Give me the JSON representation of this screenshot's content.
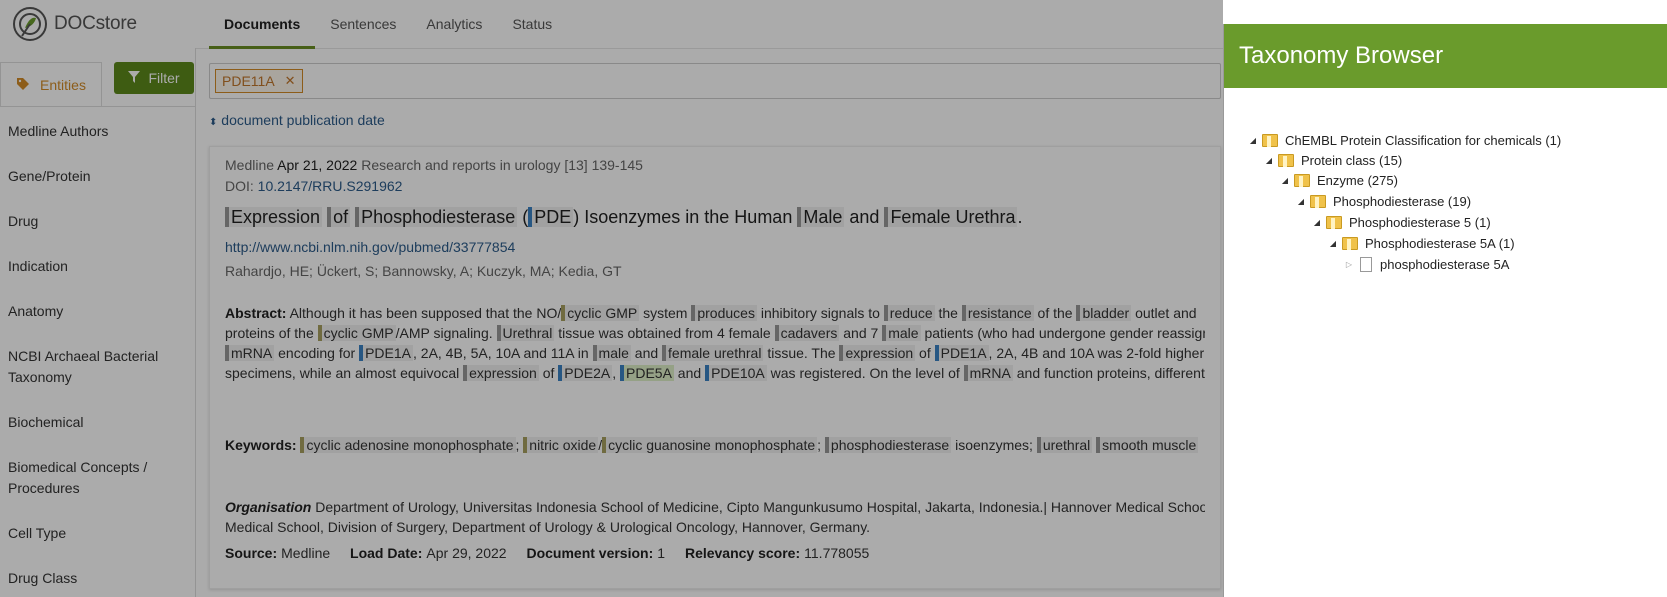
{
  "app": {
    "name": "DOCstore"
  },
  "nav": {
    "tabs": [
      "Documents",
      "Sentences",
      "Analytics",
      "Status"
    ],
    "active": "Documents"
  },
  "sidebar": {
    "tab_label": "Entities",
    "filter_label": "Filter",
    "items": [
      "Medline Authors",
      "Gene/Protein",
      "Drug",
      "Indication",
      "Anatomy",
      "NCBI Archaeal Bacterial Taxonomy",
      "Biochemical",
      "Biomedical Concepts / Procedures",
      "Cell Type",
      "Drug Class"
    ]
  },
  "search": {
    "chip": "PDE11A"
  },
  "sort": {
    "label": "document publication date"
  },
  "document": {
    "source": "Medline",
    "date": "Apr 21, 2022",
    "journal": "Research and reports in urology [13] 139-145",
    "doi_label": "DOI:",
    "doi": "10.2147/RRU.S291962",
    "title_parts": [
      "Expression",
      "of",
      "Phosphodiesterase",
      "(",
      "PDE",
      ") Isoenzymes in the Human",
      "Male",
      "and",
      "Female Urethra",
      "."
    ],
    "url": "http://www.ncbi.nlm.nih.gov/pubmed/33777854",
    "authors": "Rahardjo, HE; Ückert, S; Bannowsky, A; Kuczyk, MA; Kedia, GT",
    "abstract_label": "Abstract:",
    "abstract_lines": [
      [
        "Although it has been supposed that the NO/",
        "cyclic GMP",
        " system ",
        "produces",
        " inhibitory signals to ",
        "reduce",
        " the ",
        "resistance",
        " of the ",
        "bladder",
        " outlet and"
      ],
      [
        "proteins of the ",
        "cyclic GMP",
        "/AMP signaling. ",
        "Urethral",
        " tissue was obtained from 4 female ",
        "cadavers",
        " and 7 ",
        "male",
        " patients (who had undergone gender reassign"
      ],
      [
        "",
        "mRNA",
        " encoding for ",
        "PDE1A",
        ", 2A, 4B, 5A, 10A and 11A in ",
        "male",
        " and ",
        "female urethral",
        " tissue. The ",
        "expression",
        " of ",
        "PDE1A",
        ", 2A, 4B and 10A was 2-fold higher"
      ],
      [
        "specimens, while an almost equivocal ",
        "expression",
        " of ",
        "PDE2A",
        ", ",
        "PDE5A",
        " and ",
        "PDE10A",
        " was registered. On the level of ",
        "mRNA",
        " and function proteins, different p"
      ]
    ],
    "keywords_label": "Keywords:",
    "keywords": [
      "cyclic adenosine monophosphate",
      "; ",
      "nitric oxide",
      "/",
      "cyclic guanosine monophosphate",
      "; ",
      "phosphodiesterase",
      " isoenzymes; ",
      "urethral",
      " ",
      "smooth muscle"
    ],
    "org_label": "Organisation",
    "org_line1": "Department of Urology, Universitas Indonesia School of Medicine, Cipto Mangunkusumo Hospital, Jakarta, Indonesia.| Hannover Medical School,",
    "org_line2": "Medical School, Division of Surgery, Department of Urology & Urological Oncology, Hannover, Germany.",
    "source_label": "Source:",
    "source_value": "Medline",
    "load_label": "Load Date:",
    "load_value": "Apr 29, 2022",
    "version_label": "Document version:",
    "version_value": "1",
    "relevancy_label": "Relevancy score:",
    "relevancy_value": "11.778055"
  },
  "taxonomy": {
    "title": "Taxonomy Browser",
    "nodes": [
      {
        "label": "ChEMBL Protein Classification for chemicals (1)",
        "depth": 0,
        "kind": "folder",
        "expanded": true
      },
      {
        "label": "Protein class (15)",
        "depth": 1,
        "kind": "folder",
        "expanded": true
      },
      {
        "label": "Enzyme (275)",
        "depth": 2,
        "kind": "folder",
        "expanded": true
      },
      {
        "label": "Phosphodiesterase (19)",
        "depth": 3,
        "kind": "folder",
        "expanded": true
      },
      {
        "label": "Phosphodiesterase 5 (1)",
        "depth": 4,
        "kind": "folder",
        "expanded": true
      },
      {
        "label": "Phosphodiesterase 5A (1)",
        "depth": 5,
        "kind": "folder",
        "expanded": true
      },
      {
        "label": "phosphodiesterase 5A",
        "depth": 6,
        "kind": "file",
        "expanded": false
      }
    ]
  },
  "colors": {
    "brand_green": "#6a9b2c",
    "filter_green": "#5d8a1c",
    "link": "#2c5b8a",
    "entity_orange": "#d28b28"
  }
}
